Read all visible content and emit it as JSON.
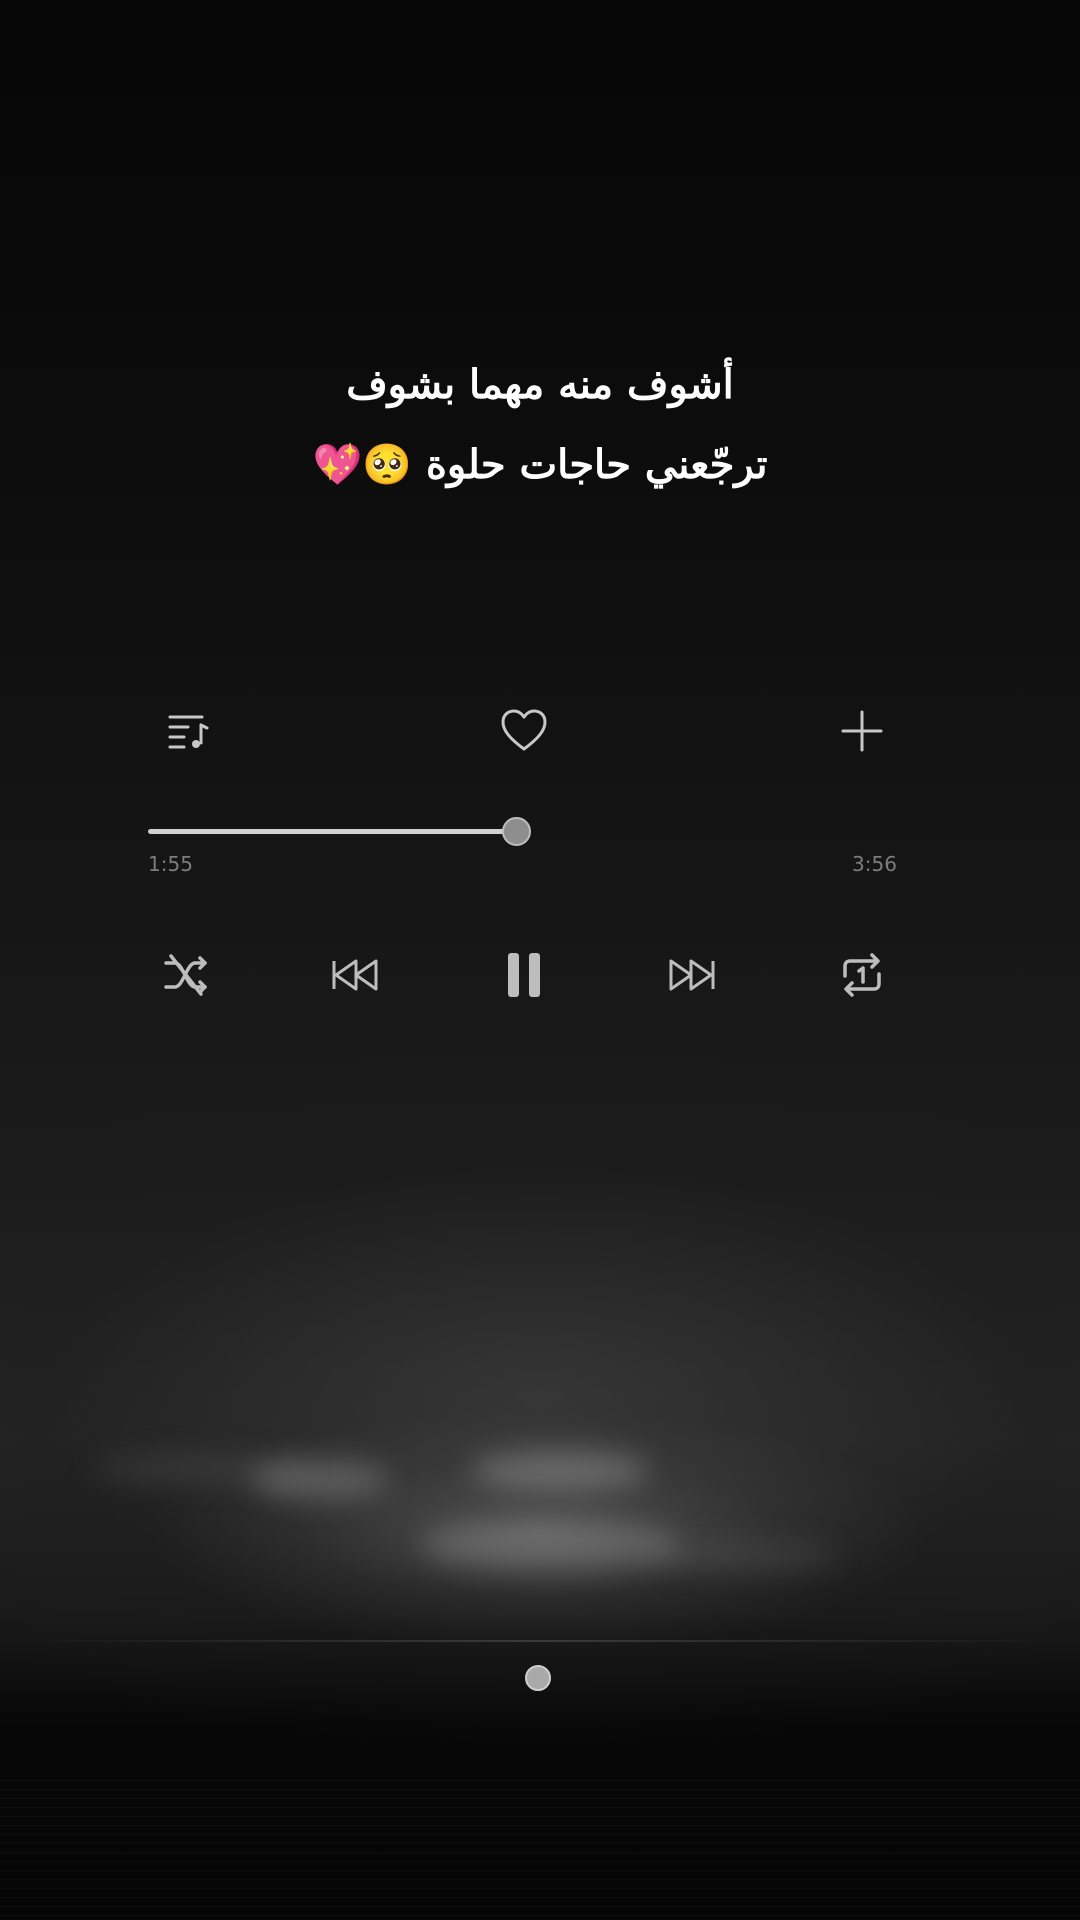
{
  "lyrics": {
    "line1": "أشوف منه مهما بشوف",
    "line2": "ترجّعني حاجات حلوة 🥺💖"
  },
  "player": {
    "elapsed": "1:55",
    "total": "3:56",
    "progress": 0.49
  },
  "controls": {
    "top": [
      "queue-icon",
      "heart-icon",
      "plus-icon"
    ],
    "bottom": [
      "shuffle-icon",
      "previous-icon",
      "pause-icon",
      "next-icon",
      "repeat-one-icon"
    ]
  },
  "colors": {
    "background": "#0c0c0c",
    "icon": "#c8c8c8",
    "text": "#ffffff",
    "time_text": "#7d7d7d"
  }
}
